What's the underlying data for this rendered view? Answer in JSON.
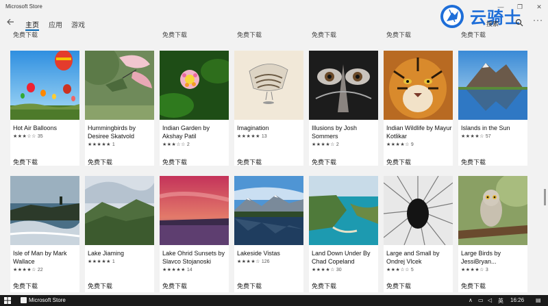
{
  "window": {
    "title": "Microsoft Store"
  },
  "nav": {
    "tabs": [
      "主页",
      "应用",
      "游戏"
    ],
    "search_label": "搜索"
  },
  "watermark": {
    "text": "云骑士"
  },
  "top_row_prices": [
    "免费下载",
    "免费下载",
    "免费下载",
    "免费下载",
    "免费下载",
    "免费下载"
  ],
  "tiles_row1": [
    {
      "name": "Hot Air Balloons",
      "stars": "★★★☆☆",
      "count": "35",
      "price": "免费下载"
    },
    {
      "name": "Hummingbirds by Desiree Skatvold",
      "stars": "★★★★★",
      "count": "1",
      "price": "免费下载"
    },
    {
      "name": "Indian Garden by Akshay Patil",
      "stars": "★★★☆☆",
      "count": "2",
      "price": "免费下载"
    },
    {
      "name": "Imagination",
      "stars": "★★★★★",
      "count": "13",
      "price": "免费下载"
    },
    {
      "name": "Illusions by Josh Sommers",
      "stars": "★★★★☆",
      "count": "2",
      "price": "免费下载"
    },
    {
      "name": "Indian Wildlife by Mayur Kotlikar",
      "stars": "★★★★☆",
      "count": "9",
      "price": "免费下载"
    },
    {
      "name": "Islands in the Sun",
      "stars": "★★★★☆",
      "count": "57",
      "price": "免费下载"
    }
  ],
  "tiles_row2": [
    {
      "name": "Isle of Man by Mark Wallace",
      "stars": "★★★★☆",
      "count": "22",
      "price": "免费下载"
    },
    {
      "name": "Lake Jiaming",
      "stars": "★★★★★",
      "count": "1",
      "price": "免费下载"
    },
    {
      "name": "Lake Ohrid Sunsets by Slavco Stojanoski",
      "stars": "★★★★★",
      "count": "14",
      "price": "免费下载"
    },
    {
      "name": "Lakeside Vistas",
      "stars": "★★★★☆",
      "count": "126",
      "price": "免费下载"
    },
    {
      "name": "Land Down Under By Chad Copeland",
      "stars": "★★★★☆",
      "count": "30",
      "price": "免费下载"
    },
    {
      "name": "Large and Small by Ondrej Vlcek",
      "stars": "★★★☆☆",
      "count": "5",
      "price": "免费下载"
    },
    {
      "name": "Large Birds by JessiBryan...",
      "stars": "★★★★☆",
      "count": "3",
      "price": "免费下载"
    }
  ],
  "taskbar": {
    "app_label": "Microsoft Store",
    "ime": "英",
    "time": "16:26"
  },
  "icons": {
    "back": "back-arrow-icon",
    "search": "search-icon",
    "more": "more-icon"
  }
}
